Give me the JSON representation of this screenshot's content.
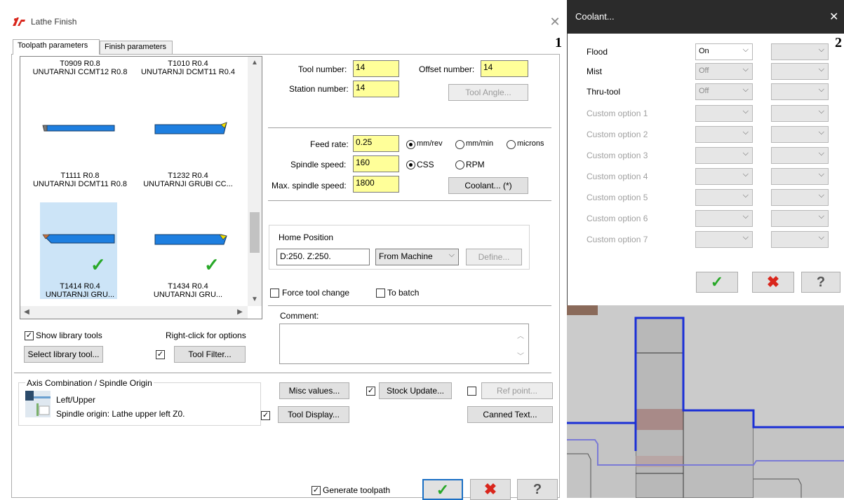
{
  "main_dialog": {
    "title": "Lathe Finish",
    "marker": "1",
    "tabs": [
      {
        "label": "Toolpath parameters"
      },
      {
        "label": "Finish parameters"
      }
    ],
    "tools": [
      {
        "line1": "T0909 R0.8",
        "line2": "UNUTARNJI CCMT12 R0.8"
      },
      {
        "line1": "T1010 R0.4",
        "line2": "UNUTARNJI DCMT11 R0.4"
      },
      {
        "line1": "T1111 R0.8",
        "line2": "UNUTARNJI DCMT11 R0.8"
      },
      {
        "line1": "T1232 R0.4",
        "line2": "UNUTARNJI GRUBI CC..."
      },
      {
        "line1": "T1414 R0.4",
        "line2": "UNUTARNJI GRU..."
      },
      {
        "line1": "T1434 R0.4",
        "line2": "UNUTARNJI GRU..."
      }
    ],
    "tool_number_label": "Tool number:",
    "tool_number": "14",
    "offset_number_label": "Offset number:",
    "offset_number": "14",
    "station_number_label": "Station number:",
    "station_number": "14",
    "tool_angle_button": "Tool Angle...",
    "feed_rate_label": "Feed rate:",
    "feed_rate": "0.25",
    "feed_units": [
      "mm/rev",
      "mm/min",
      "microns"
    ],
    "spindle_speed_label": "Spindle speed:",
    "spindle_speed": "160",
    "spindle_modes": [
      "CSS",
      "RPM"
    ],
    "max_spindle_label": "Max. spindle speed:",
    "max_spindle": "1800",
    "coolant_button": "Coolant... (*)",
    "home_position_label": "Home Position",
    "home_position_value": "D:250.  Z:250.",
    "home_source": "From Machine",
    "define_button": "Define...",
    "force_tool_change": "Force tool change",
    "to_batch": "To batch",
    "comment_label": "Comment:",
    "show_library_tools": "Show library tools",
    "right_click_hint": "Right-click for options",
    "select_library_tool": "Select library tool...",
    "tool_filter": "Tool Filter...",
    "axis_combo_label": "Axis Combination / Spindle Origin",
    "axis_combo_value": "Left/Upper",
    "spindle_origin": "Spindle origin: Lathe upper left  Z0.",
    "misc_values": "Misc values...",
    "stock_update": "Stock Update...",
    "ref_point": "Ref point...",
    "tool_display": "Tool Display...",
    "canned_text": "Canned Text...",
    "generate_toolpath": "Generate toolpath"
  },
  "coolant_dialog": {
    "title": "Coolant...",
    "marker": "2",
    "rows": [
      {
        "label": "Flood",
        "value": "On",
        "enabled": true
      },
      {
        "label": "Mist",
        "value": "Off",
        "enabled": true
      },
      {
        "label": "Thru-tool",
        "value": "Off",
        "enabled": true
      },
      {
        "label": "Custom option 1",
        "value": "",
        "enabled": false
      },
      {
        "label": "Custom option 2",
        "value": "",
        "enabled": false
      },
      {
        "label": "Custom option 3",
        "value": "",
        "enabled": false
      },
      {
        "label": "Custom option 4",
        "value": "",
        "enabled": false
      },
      {
        "label": "Custom option 5",
        "value": "",
        "enabled": false
      },
      {
        "label": "Custom option 6",
        "value": "",
        "enabled": false
      },
      {
        "label": "Custom option 7",
        "value": "",
        "enabled": false
      }
    ]
  },
  "colors": {
    "input_highlight": "#ffff99",
    "selection": "#cce4f7",
    "ok_green": "#28a828",
    "cancel_red": "#d9261c",
    "tool_blue": "#1e7fe0",
    "toolpath_blue": "#1a2fd6"
  }
}
